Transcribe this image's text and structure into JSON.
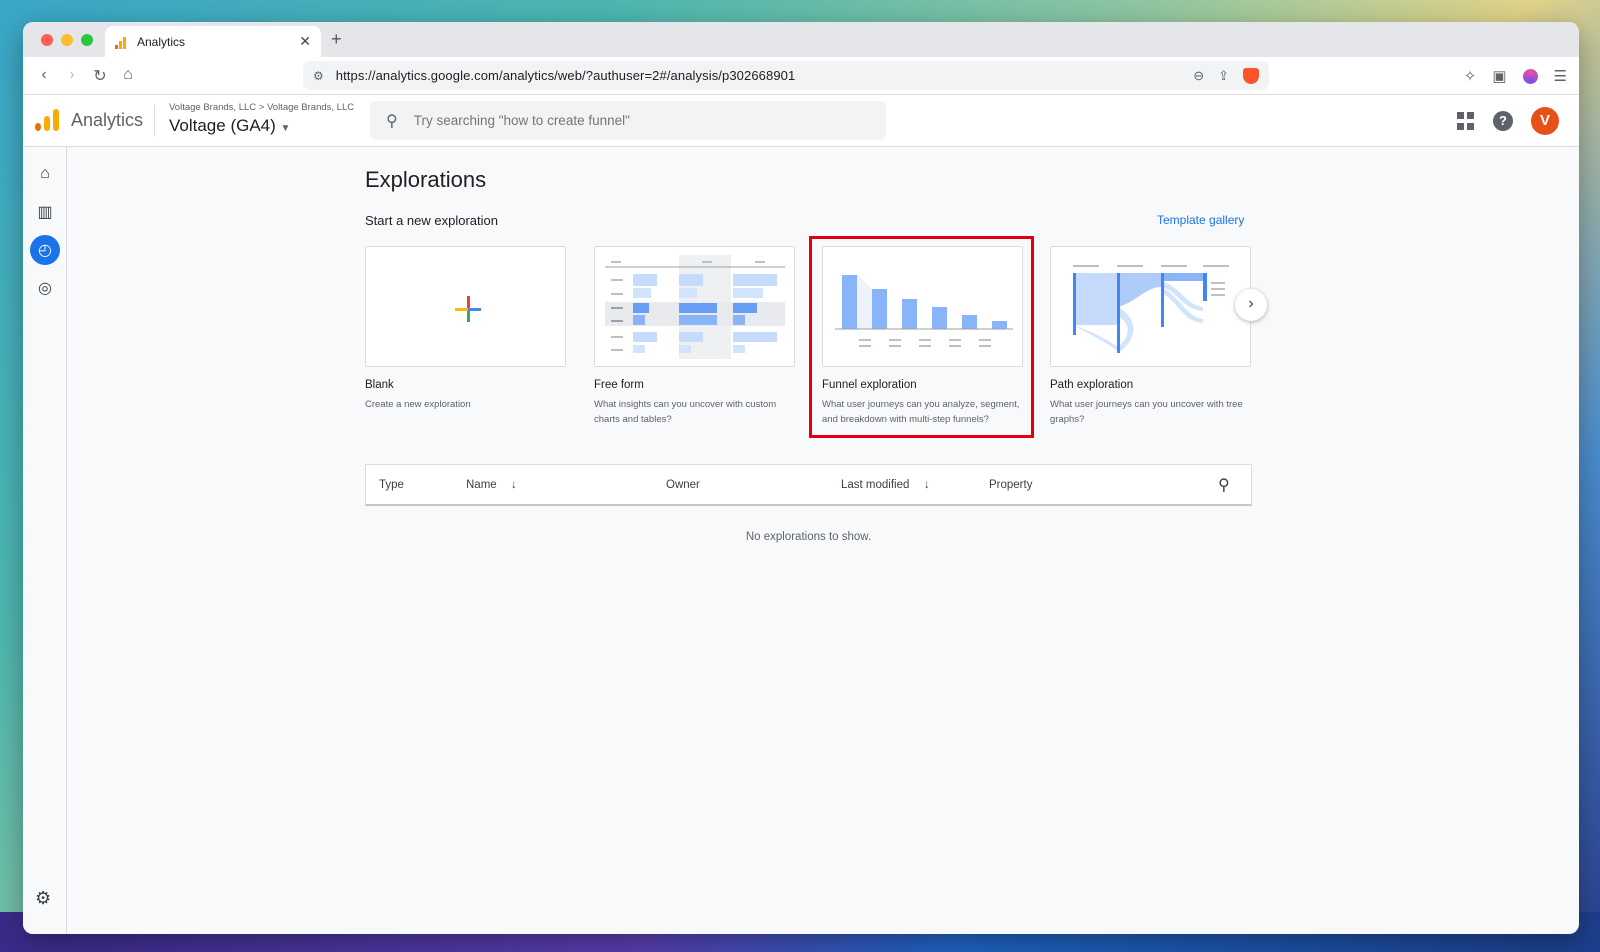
{
  "browser": {
    "tab_title": "Analytics",
    "new_tab_symbol": "+",
    "close_symbol": "✕",
    "url": "https://analytics.google.com/analytics/web/?authuser=2#/analysis/p302668901"
  },
  "header": {
    "app_name": "Analytics",
    "breadcrumb": "Voltage Brands, LLC > Voltage Brands, LLC",
    "property": "Voltage (GA4)",
    "search_placeholder": "Try searching \"how to create funnel\"",
    "help_symbol": "?",
    "avatar_letter": "V"
  },
  "main": {
    "title": "Explorations",
    "section_label": "Start a new exploration",
    "template_gallery": "Template gallery",
    "cards": [
      {
        "title": "Blank",
        "desc": "Create a new exploration"
      },
      {
        "title": "Free form",
        "desc": "What insights can you uncover with custom charts and tables?"
      },
      {
        "title": "Funnel exploration",
        "desc": "What user journeys can you analyze, segment, and breakdown with multi-step funnels?"
      },
      {
        "title": "Path exploration",
        "desc": "What user journeys can you uncover with tree graphs?"
      }
    ],
    "table": {
      "columns": [
        "Type",
        "Name",
        "Owner",
        "Last modified",
        "Property"
      ],
      "sort_symbol": "↓",
      "empty_message": "No explorations to show."
    }
  },
  "colors": {
    "accent": "#1a73e8",
    "highlight": "#e2000f",
    "avatar": "#e8501a"
  }
}
